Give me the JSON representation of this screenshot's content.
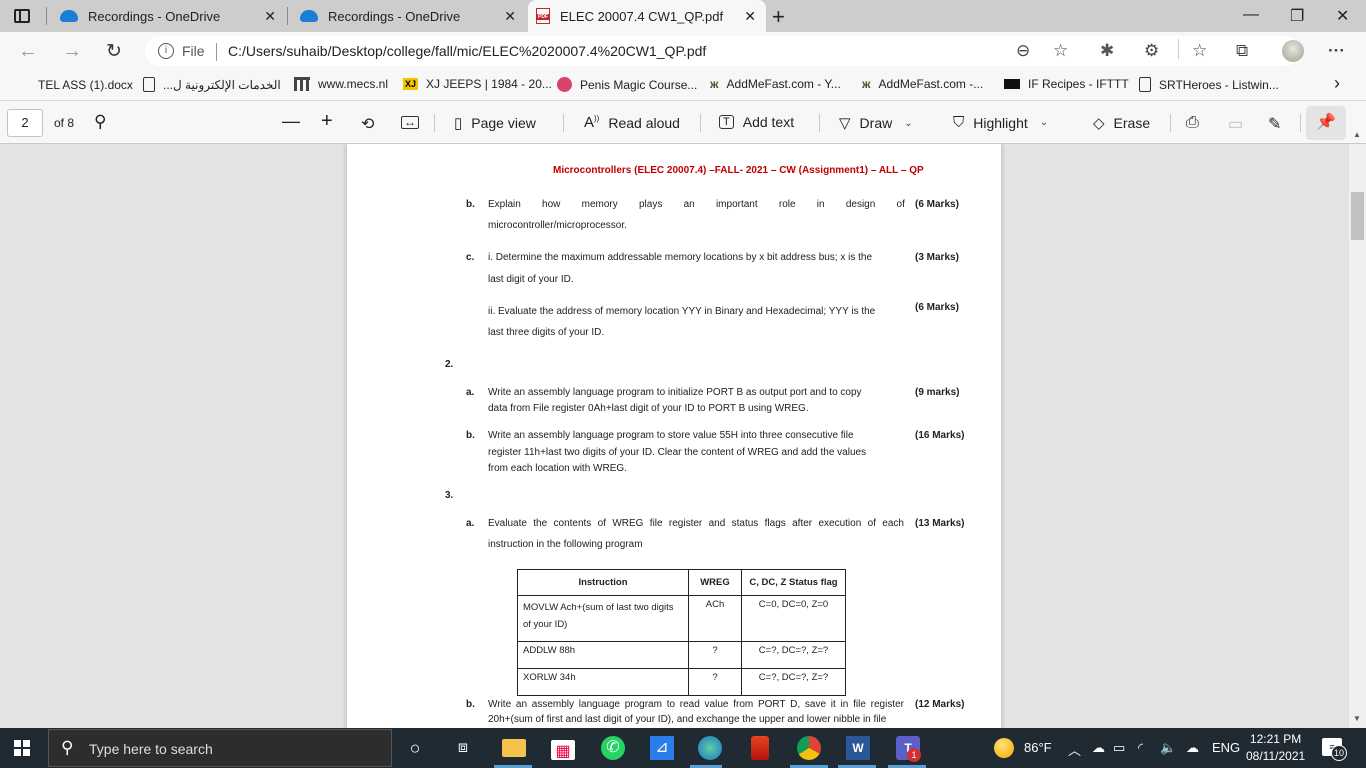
{
  "browser": {
    "tabs": [
      {
        "title": "Recordings - OneDrive",
        "icon": "onedrive-icon",
        "active": false
      },
      {
        "title": "Recordings - OneDrive",
        "icon": "onedrive-icon",
        "active": false
      },
      {
        "title": "ELEC 20007.4 CW1_QP.pdf",
        "icon": "pdf-icon",
        "active": true
      }
    ],
    "close_glyph": "✕",
    "new_tab_glyph": "+",
    "window_controls": {
      "minimize": "—",
      "restore": "❐",
      "close": "✕"
    },
    "address": {
      "scheme_label": "File",
      "url": "C:/Users/suhaib/Desktop/college/fall/mic/ELEC%2020007.4%20CW1_QP.pdf"
    },
    "favorites": [
      {
        "label": "TEL ASS (1).docx",
        "icon": "microsoft-icon"
      },
      {
        "label": "الخدمات الإلكترونية ل...",
        "icon": "document-icon"
      },
      {
        "label": "www.mecs.nl",
        "icon": "mecs-icon"
      },
      {
        "label": "XJ JEEPS | 1984 - 20...",
        "icon": "xj-icon"
      },
      {
        "label": "Penis Magic Course...",
        "icon": "pink-logo-icon"
      },
      {
        "label": "AddMeFast.com - Y...",
        "icon": "addmefast-icon"
      },
      {
        "label": "AddMeFast.com -...",
        "icon": "addmefast-icon"
      },
      {
        "label": "IF Recipes - IFTTT",
        "icon": "ifttt-icon"
      },
      {
        "label": "SRTHeroes - Listwin...",
        "icon": "document-icon"
      }
    ],
    "more_favorites_glyph": "›"
  },
  "pdf_toolbar": {
    "current_page": "2",
    "total_pages_label": "of 8",
    "page_view_label": "Page view",
    "read_aloud_label": "Read aloud",
    "add_text_label": "Add text",
    "draw_label": "Draw",
    "highlight_label": "Highlight",
    "erase_label": "Erase"
  },
  "document": {
    "header": "Microcontrollers (ELEC 20007.4) –FALL- 2021 – CW (Assignment1) – ALL – QP",
    "q1b": {
      "letter": "b.",
      "line1_words": [
        "Explain",
        "how",
        "memory",
        "plays",
        "an",
        "important",
        "role",
        "in",
        "design",
        "of"
      ],
      "line2": "microcontroller/microprocessor.",
      "marks": "(6 Marks)"
    },
    "q1c": {
      "letter": "c.",
      "i_line1": "i. Determine the maximum addressable memory locations by x bit address bus; x is the",
      "i_line2": "last digit of your ID.",
      "i_marks": "(3 Marks)",
      "ii_line1": "ii. Evaluate the address of memory location YYY in Binary and Hexadecimal; YYY is the",
      "ii_line2": "last three digits of your ID.",
      "ii_marks": "(6 Marks)"
    },
    "q2": {
      "number": "2.",
      "a_letter": "a.",
      "a_line1": "Write an assembly language program to initialize PORT B as output port and to copy",
      "a_line2": "data from File register 0Ah+last digit of your ID to PORT B  using WREG.",
      "a_marks": "(9 marks)",
      "b_letter": "b.",
      "b_line1": "Write an assembly language program  to store value 55H into three consecutive file",
      "b_line2": "register 11h+last  two digits of your ID. Clear the content of WREG and add the values",
      "b_line3": "from each location with WREG.",
      "b_marks": "(16 Marks)"
    },
    "q3": {
      "number": "3.",
      "a_letter": "a.",
      "a_line1": "Evaluate the contents of WREG file register and status flags after execution of each",
      "a_line2": "instruction in the following program",
      "a_marks": "(13 Marks)",
      "table": {
        "headers": [
          "Instruction",
          "WREG",
          "C, DC, Z Status flag"
        ],
        "rows": [
          [
            "MOVLW Ach+(sum of last two digits of your ID)",
            "ACh",
            "C=0, DC=0, Z=0"
          ],
          [
            "ADDLW 88h",
            "?",
            "C=?, DC=?, Z=?"
          ],
          [
            "XORLW 34h",
            "?",
            "C=?, DC=?, Z=?"
          ]
        ]
      },
      "b_letter": "b.",
      "b_line1": "Write an assembly language program to read value from PORT D, save it in file register",
      "b_line2": "20h+(sum of first and last digit of your ID), and exchange the upper and lower nibble in file",
      "b_marks": "(12 Marks)"
    }
  },
  "taskbar": {
    "search_placeholder": "Type here to search",
    "weather": "86°F",
    "language": "ENG",
    "time": "12:21 PM",
    "date": "08/11/2021",
    "notification_count": "10",
    "teams_badge": "1"
  },
  "colors": {
    "header_red": "#c00000",
    "accent_blue": "#1c7ed6"
  }
}
